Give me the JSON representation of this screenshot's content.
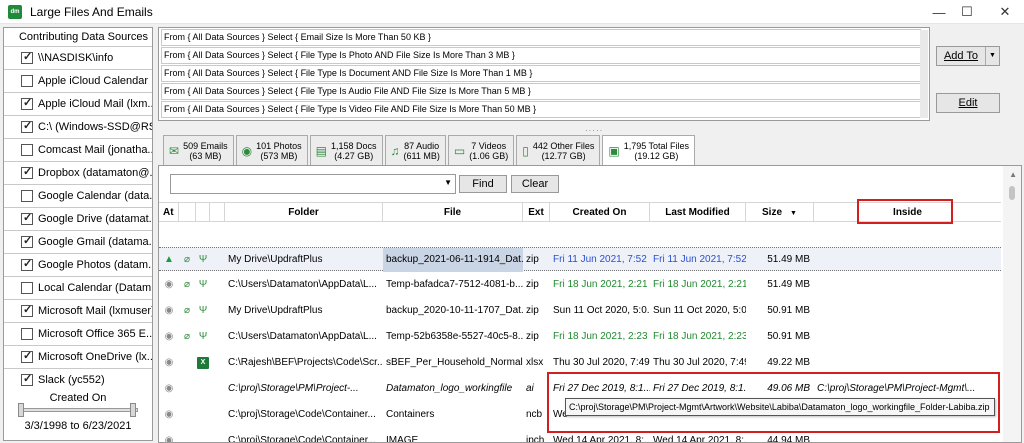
{
  "window": {
    "app_icon_text": "dm",
    "title": "Large Files And Emails",
    "min_glyph": "—",
    "max_glyph": "☐",
    "close_glyph": "✕"
  },
  "sources": {
    "header": "Contributing Data Sources",
    "items": [
      {
        "label": "\\\\NASDISK\\info",
        "checked": true
      },
      {
        "label": "Apple iCloud Calendar ...",
        "checked": false
      },
      {
        "label": "Apple iCloud Mail (lxm...",
        "checked": true
      },
      {
        "label": "C:\\ (Windows-SSD@RS...",
        "checked": true
      },
      {
        "label": "Comcast Mail (jonatha...",
        "checked": false
      },
      {
        "label": "Dropbox (datamaton@...",
        "checked": true
      },
      {
        "label": "Google Calendar (data...",
        "checked": false
      },
      {
        "label": "Google Drive (datamat...",
        "checked": true
      },
      {
        "label": "Google Gmail (datama...",
        "checked": true
      },
      {
        "label": "Google Photos (datam...",
        "checked": true
      },
      {
        "label": "Local Calendar (Datam...",
        "checked": false
      },
      {
        "label": "Microsoft Mail (lxmuser)",
        "checked": true
      },
      {
        "label": "Microsoft Office 365 E...",
        "checked": false
      },
      {
        "label": "Microsoft OneDrive (lx...",
        "checked": true
      },
      {
        "label": "Slack (yc552)",
        "checked": true
      }
    ],
    "created_on_label": "Created On",
    "date_range": "3/3/1998 to 6/23/2021"
  },
  "queries": [
    "From { All Data Sources } Select { Email Size Is More Than 50 KB }",
    "From { All Data Sources } Select { File Type Is Photo AND File Size Is More Than 3 MB }",
    "From { All Data Sources } Select { File Type Is Document AND File Size Is More Than 1 MB }",
    "From { All Data Sources } Select { File Type Is Audio File AND File Size Is More Than 5 MB }",
    "From { All Data Sources } Select { File Type Is Video File AND File Size Is More Than 50 MB }"
  ],
  "buttons": {
    "add_to": "Add To",
    "edit": "Edit",
    "find": "Find",
    "clear": "Clear",
    "dropdown_arrow": "▼"
  },
  "tabs": [
    {
      "icon": "✉",
      "line1": "509 Emails",
      "line2": "(63 MB)"
    },
    {
      "icon": "◉",
      "line1": "101 Photos",
      "line2": "(573 MB)"
    },
    {
      "icon": "▤",
      "line1": "1,158 Docs",
      "line2": "(4.27 GB)"
    },
    {
      "icon": "♫",
      "line1": "87 Audio",
      "line2": "(611 MB)"
    },
    {
      "icon": "▭",
      "line1": "7 Videos",
      "line2": "(1.06 GB)"
    },
    {
      "icon": "▯",
      "line1": "442 Other Files",
      "line2": "(12.77 GB)"
    },
    {
      "icon": "▣",
      "line1": "1,795 Total Files",
      "line2": "(19.12 GB)"
    }
  ],
  "columns": {
    "at": "At",
    "folder": "Folder",
    "file": "File",
    "ext": "Ext",
    "created": "Created On",
    "modified": "Last Modified",
    "size": "Size",
    "inside": "Inside",
    "sort_arrow": "▼"
  },
  "icon_glyphs": {
    "gdrive": "▲",
    "eye": "◉",
    "clip": "⌀",
    "ph": "Ψ",
    "xl": "X"
  },
  "rows": [
    {
      "folder": "My Drive\\UpdraftPlus",
      "file": "backup_2021-06-11-1914_Dat...",
      "ext": "zip",
      "created": "Fri 11 Jun 2021, 7:52 ...",
      "modified": "Fri 11 Jun 2021, 7:52 ...",
      "size": "51.49 MB",
      "inside": ""
    },
    {
      "folder": "C:\\Users\\Datamaton\\AppData\\L...",
      "file": "Temp-bafadca7-7512-4081-b...",
      "ext": "zip",
      "created": "Fri 18 Jun 2021, 2:21 ...",
      "modified": "Fri 18 Jun 2021, 2:21 ...",
      "size": "51.49 MB",
      "inside": ""
    },
    {
      "folder": "My Drive\\UpdraftPlus",
      "file": "backup_2020-10-11-1707_Dat...",
      "ext": "zip",
      "created": "Sun 11 Oct 2020, 5:0...",
      "modified": "Sun 11 Oct 2020, 5:0...",
      "size": "50.91 MB",
      "inside": ""
    },
    {
      "folder": "C:\\Users\\Datamaton\\AppData\\L...",
      "file": "Temp-52b6358e-5527-40c5-8...",
      "ext": "zip",
      "created": "Fri 18 Jun 2021, 2:23 ...",
      "modified": "Fri 18 Jun 2021, 2:23 ...",
      "size": "50.91 MB",
      "inside": ""
    },
    {
      "folder": "C:\\Rajesh\\BEF\\Projects\\Code\\Scr...",
      "file": "sBEF_Per_Household_Normal...",
      "ext": "xlsx",
      "created": "Thu 30 Jul 2020, 7:49...",
      "modified": "Thu 30 Jul 2020, 7:49...",
      "size": "49.22 MB",
      "inside": ""
    },
    {
      "folder": "C:\\proj\\Storage\\PM\\Project-...",
      "file": "Datamaton_logo_workingfile",
      "ext": "ai",
      "created": "Fri 27 Dec 2019, 8:1...",
      "modified": "Fri 27 Dec 2019, 8:1...",
      "size": "49.06 MB",
      "inside": "C:\\proj\\Storage\\PM\\Project-Mgmt\\..."
    },
    {
      "folder": "C:\\proj\\Storage\\Code\\Container...",
      "file": "Containers",
      "ext": "ncb",
      "created": "We",
      "modified": "",
      "size": "",
      "inside": ""
    },
    {
      "folder": "C:\\proj\\Storage\\Code\\Container...",
      "file": "IMAGE",
      "ext": "ipch",
      "created": "Wed 14 Apr 2021, 8:...",
      "modified": "Wed 14 Apr 2021, 8:...",
      "size": "44.94 MB",
      "inside": ""
    }
  ],
  "tooltip": "C:\\proj\\Storage\\PM\\Project-Mgmt\\Artwork\\Website\\Labiba\\Datamaton_logo_workingfile_Folder-Labiba.zip",
  "colors": {
    "accent_red": "#d21f1f",
    "date_green": "#1f8a2e",
    "date_blue": "#2a4fd0",
    "icon_green": "#1f8a3a"
  }
}
